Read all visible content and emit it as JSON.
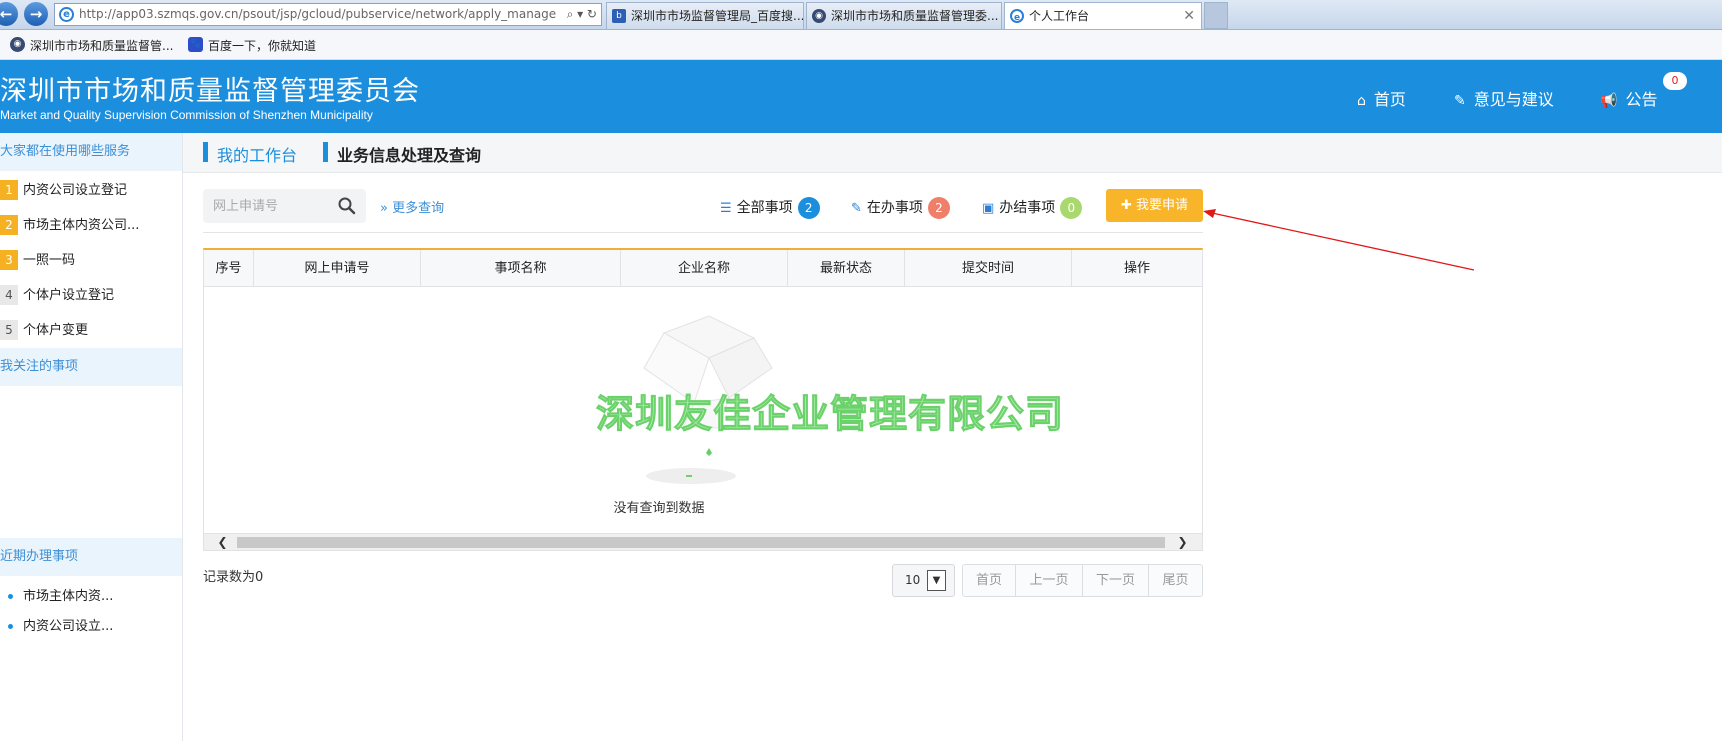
{
  "browser": {
    "address_url": "http://app03.szmqs.gov.cn/psout/jsp/gcloud/pubservice/network/apply_manage",
    "tabs": [
      {
        "label": "深圳市市场监督管理局_百度搜..."
      },
      {
        "label": "深圳市市场和质量监督管理委..."
      },
      {
        "label": "个人工作台"
      }
    ],
    "favorites": [
      {
        "label": "深圳市市场和质量监督管..."
      },
      {
        "label": "百度一下，你就知道"
      }
    ]
  },
  "header": {
    "title": "深圳市市场和质量监督管理委员会",
    "subtitle": "Market and Quality Supervision Commission of Shenzhen Municipality",
    "nav": {
      "home": "首页",
      "feedback": "意见与建议",
      "notice": "公告"
    },
    "notice_count": "0"
  },
  "sidebar": {
    "popular_heading": "大家都在使用哪些服务",
    "popular": [
      {
        "num": "1",
        "label": "内资公司设立登记"
      },
      {
        "num": "2",
        "label": "市场主体内资公司..."
      },
      {
        "num": "3",
        "label": "一照一码"
      },
      {
        "num": "4",
        "label": "个体户设立登记"
      },
      {
        "num": "5",
        "label": "个体户变更"
      }
    ],
    "followed_heading": "我关注的事项",
    "recent_heading": "近期办理事项",
    "recent": [
      {
        "label": "市场主体内资..."
      },
      {
        "label": "内资公司设立..."
      }
    ]
  },
  "breadcrumb": {
    "workbench": "我的工作台",
    "business": "业务信息处理及查询"
  },
  "toolbar": {
    "search_placeholder": "网上申请号",
    "more_query": "更多查询",
    "all_items": "全部事项",
    "all_count": "2",
    "in_progress": "在办事项",
    "in_progress_count": "2",
    "completed": "办结事项",
    "completed_count": "0",
    "apply_label": "我要申请"
  },
  "table": {
    "columns": [
      "序号",
      "网上申请号",
      "事项名称",
      "企业名称",
      "最新状态",
      "提交时间",
      "操作"
    ],
    "rows": [],
    "empty_text": "没有查询到数据"
  },
  "watermark": "深圳友佳企业管理有限公司",
  "footer": {
    "record_count": "记录数为0",
    "page_size": "10",
    "pager": {
      "first": "首页",
      "prev": "上一页",
      "next": "下一页",
      "last": "尾页"
    }
  },
  "colors": {
    "brand_blue": "#1c8ede",
    "apply_orange": "#f9b52a",
    "badge_all": "#1c8ede",
    "badge_in_progress": "#f07f6a",
    "badge_completed": "#a9d86e",
    "annotation_red": "#e01818"
  }
}
